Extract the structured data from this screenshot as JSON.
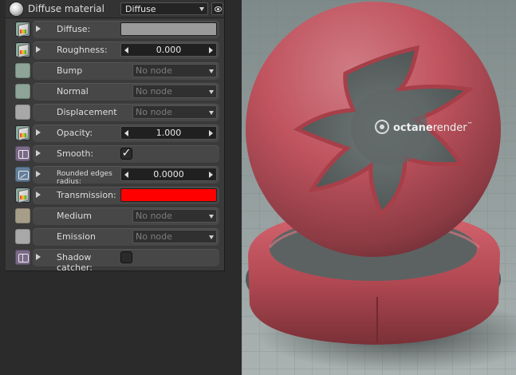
{
  "material_panel": {
    "title": "Diffuse material",
    "type_select": {
      "value": "Diffuse"
    },
    "rows": [
      {
        "label": "Diffuse:",
        "icon": "texture-icon",
        "control": "color",
        "color": "#9a9a9a"
      },
      {
        "label": "Roughness:",
        "icon": "texture-icon",
        "control": "spinner",
        "value": "0.000"
      },
      {
        "label": "Bump",
        "icon": "bump-node-icon",
        "control": "node",
        "value": "No node"
      },
      {
        "label": "Normal",
        "icon": "normal-node-icon",
        "control": "node",
        "value": "No node"
      },
      {
        "label": "Displacement",
        "icon": "displacement-node-icon",
        "control": "node",
        "value": "No node"
      },
      {
        "label": "Opacity:",
        "icon": "texture-icon",
        "control": "spinner",
        "value": "1.000"
      },
      {
        "label": "Smooth:",
        "icon": "bool-icon",
        "control": "check",
        "checked": true,
        "check_glyph": "✓"
      },
      {
        "label": "Rounded edges radius:",
        "icon": "float-icon",
        "control": "spinner",
        "value": "0.0000"
      },
      {
        "label": "Transmission:",
        "icon": "texture-icon",
        "control": "color",
        "color": "#ff0000"
      },
      {
        "label": "Medium",
        "icon": "medium-node-icon",
        "control": "node",
        "value": "No node"
      },
      {
        "label": "Emission",
        "icon": "emission-node-icon",
        "control": "node",
        "value": "No node"
      },
      {
        "label": "Shadow catcher:",
        "icon": "bool-icon",
        "control": "check",
        "checked": false,
        "check_glyph": ""
      }
    ]
  },
  "render": {
    "logo_text_bold": "octane",
    "logo_text_light": "render",
    "logo_mark": "™",
    "material_color": "#c0545f"
  }
}
